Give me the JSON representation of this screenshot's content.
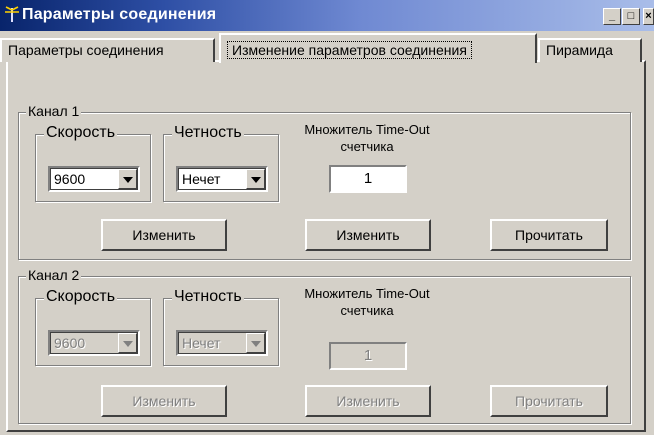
{
  "window": {
    "title": "Параметры соединения",
    "controls": {
      "minimize": "_",
      "maximize": "□",
      "close": "×"
    }
  },
  "tabs": [
    {
      "label": "Параметры соединения",
      "active": false
    },
    {
      "label": "Изменение параметров соединения",
      "active": true
    },
    {
      "label": "Пирамида",
      "active": false
    }
  ],
  "channel1": {
    "label": "Канал 1",
    "speed": {
      "label": "Скорость",
      "value": "9600"
    },
    "parity": {
      "label": "Четность",
      "value": "Нечет"
    },
    "multiplier": {
      "label_line1": "Множитель Time-Out",
      "label_line2": "счетчика",
      "value": "1"
    },
    "buttons": {
      "change1": "Изменить",
      "change2": "Изменить",
      "read": "Прочитать"
    }
  },
  "channel2": {
    "label": "Канал 2",
    "speed": {
      "label": "Скорость",
      "value": "9600"
    },
    "parity": {
      "label": "Четность",
      "value": "Нечет"
    },
    "multiplier": {
      "label_line1": "Множитель Time-Out",
      "label_line2": "счетчика",
      "value": "1"
    },
    "buttons": {
      "change1": "Изменить",
      "change2": "Изменить",
      "read": "Прочитать"
    },
    "enabled": false
  }
}
